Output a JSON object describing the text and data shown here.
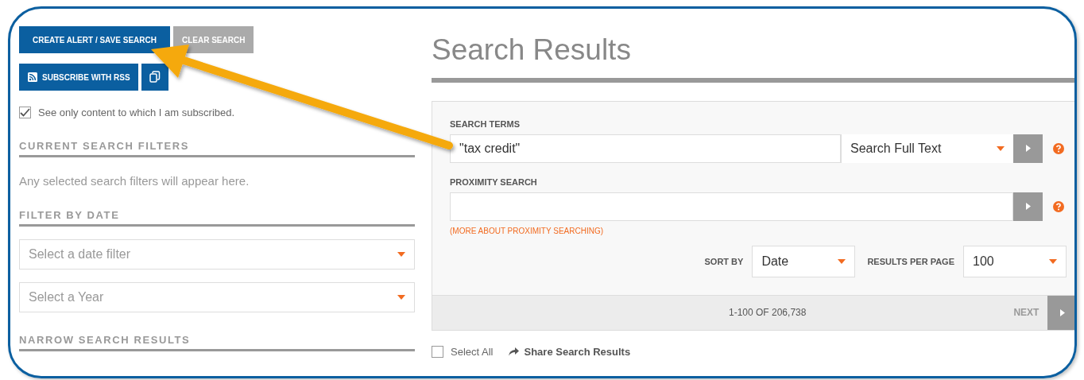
{
  "sidebar": {
    "buttons": [
      {
        "kind": "primary",
        "label": "CREATE ALERT / SAVE SEARCH"
      },
      {
        "kind": "secondary",
        "label": "CLEAR SEARCH"
      },
      {
        "kind": "rss",
        "label": "SUBSCRIBE WITH RSS"
      },
      {
        "kind": "copy"
      }
    ],
    "subscribed_filter": {
      "label": "See only content to which I am subscribed.",
      "checked": true
    },
    "sections": [
      {
        "heading": "CURRENT SEARCH FILTERS",
        "text": "Any selected search filters will appear here."
      },
      {
        "heading": "FILTER BY DATE",
        "selects": [
          {
            "placeholder": "Select a date filter"
          },
          {
            "placeholder": "Select a Year"
          }
        ]
      },
      {
        "heading": "NARROW SEARCH RESULTS"
      }
    ]
  },
  "main": {
    "title": "Search Results",
    "search_terms": {
      "label": "SEARCH TERMS",
      "value": "\"tax credit\"",
      "scope": "Search Full Text"
    },
    "proximity": {
      "label": "PROXIMITY SEARCH",
      "link": "(MORE ABOUT PROXIMITY SEARCHING)"
    },
    "sort": {
      "label": "SORT BY",
      "value": "Date"
    },
    "per_page": {
      "label": "RESULTS PER PAGE",
      "value": "100"
    },
    "pagination": {
      "range": "1-100 OF 206,738",
      "next": "NEXT"
    },
    "select_all": {
      "label": "Select All",
      "checked": false
    },
    "share": "Share Search Results"
  }
}
